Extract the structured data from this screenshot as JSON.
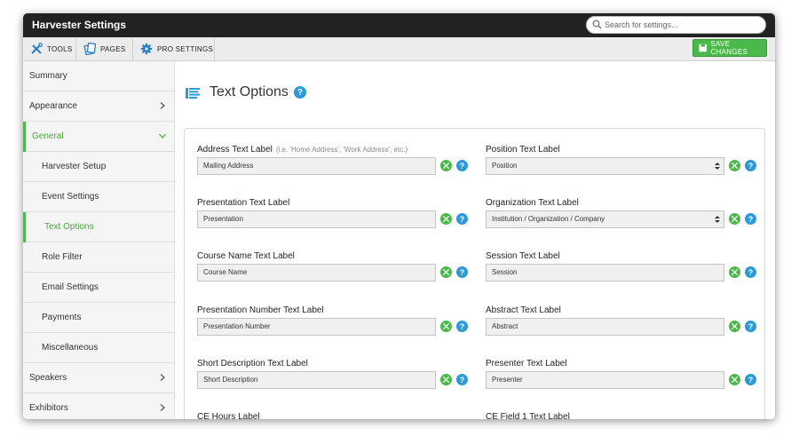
{
  "window": {
    "title": "Harvester Settings"
  },
  "search": {
    "placeholder": "Search for settings..."
  },
  "toolbar": {
    "tools_label": "TOOLS",
    "pages_label": "PAGES",
    "pro_label": "PRO SETTINGS",
    "save_label": "SAVE CHANGES"
  },
  "sidebar": {
    "items": [
      {
        "label": "Summary"
      },
      {
        "label": "Appearance"
      },
      {
        "label": "General"
      },
      {
        "label": "Harvester Setup"
      },
      {
        "label": "Event Settings"
      },
      {
        "label": "Text Options"
      },
      {
        "label": "Role Filter"
      },
      {
        "label": "Email Settings"
      },
      {
        "label": "Payments"
      },
      {
        "label": "Miscellaneous"
      },
      {
        "label": "Speakers"
      },
      {
        "label": "Exhibitors"
      }
    ]
  },
  "main": {
    "title": "Text Options",
    "help_symbol": "?",
    "fields": [
      {
        "label": "Address Text Label",
        "hint": "(i.e. 'Home Address', 'Work Address', etc.)",
        "value": "Mailing Address"
      },
      {
        "label": "Position Text Label",
        "hint": "",
        "value": "Position"
      },
      {
        "label": "Presentation Text Label",
        "hint": "",
        "value": "Presentation"
      },
      {
        "label": "Organization Text Label",
        "hint": "",
        "value": "Institution / Organization / Company"
      },
      {
        "label": "Course Name Text Label",
        "hint": "",
        "value": "Course Name"
      },
      {
        "label": "Session Text Label",
        "hint": "",
        "value": "Session"
      },
      {
        "label": "Presentation Number Text Label",
        "hint": "",
        "value": "Presentation Number"
      },
      {
        "label": "Abstract Text Label",
        "hint": "",
        "value": "Abstract"
      },
      {
        "label": "Short Description Text Label",
        "hint": "",
        "value": "Short Description"
      },
      {
        "label": "Presenter Text Label",
        "hint": "",
        "value": "Presenter"
      },
      {
        "label": "CE Hours Label",
        "hint": "",
        "value": ""
      },
      {
        "label": "CE Field 1 Text Label",
        "hint": "",
        "value": ""
      }
    ]
  },
  "colors": {
    "accent": "#4bb84b",
    "help": "#2a9bd8",
    "titlebar": "#222222"
  }
}
